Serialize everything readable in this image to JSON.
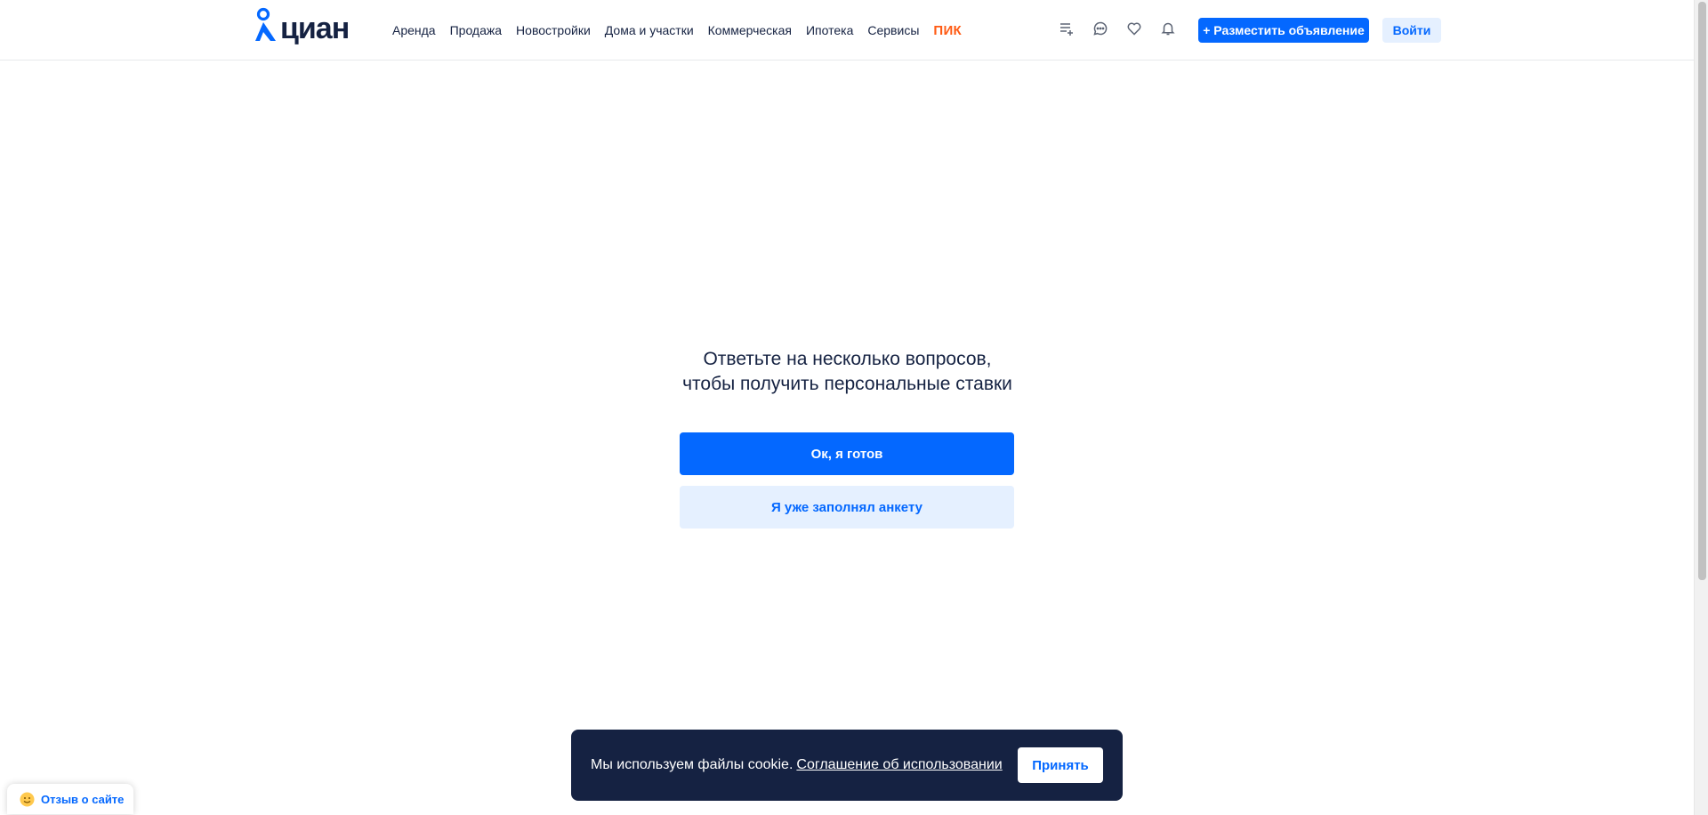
{
  "header": {
    "logo_text": "циан",
    "nav": [
      {
        "label": "Аренда"
      },
      {
        "label": "Продажа"
      },
      {
        "label": "Новостройки"
      },
      {
        "label": "Дома и участки"
      },
      {
        "label": "Коммерческая"
      },
      {
        "label": "Ипотека"
      },
      {
        "label": "Сервисы"
      }
    ],
    "pik_label": "ПИК",
    "icons": [
      "compare-list-icon",
      "chat-icon",
      "heart-icon",
      "bell-icon"
    ],
    "post_button": "+ Разместить объявление",
    "login_button": "Войти"
  },
  "main": {
    "title_line1": "Ответьте на несколько вопросов,",
    "title_line2": "чтобы получить персональные ставки",
    "ready_button": "Ок, я готов",
    "filled_button": "Я уже заполнял анкету"
  },
  "cookie": {
    "text": "Мы используем файлы cookie.",
    "link": "Соглашение об использовании",
    "accept": "Принять"
  },
  "feedback": {
    "label": "Отзыв о сайте"
  },
  "colors": {
    "brand_blue": "#0468ff",
    "dark_navy": "#152242",
    "light_blue": "#e5f0ff",
    "pik_orange": "#ff5b14"
  }
}
